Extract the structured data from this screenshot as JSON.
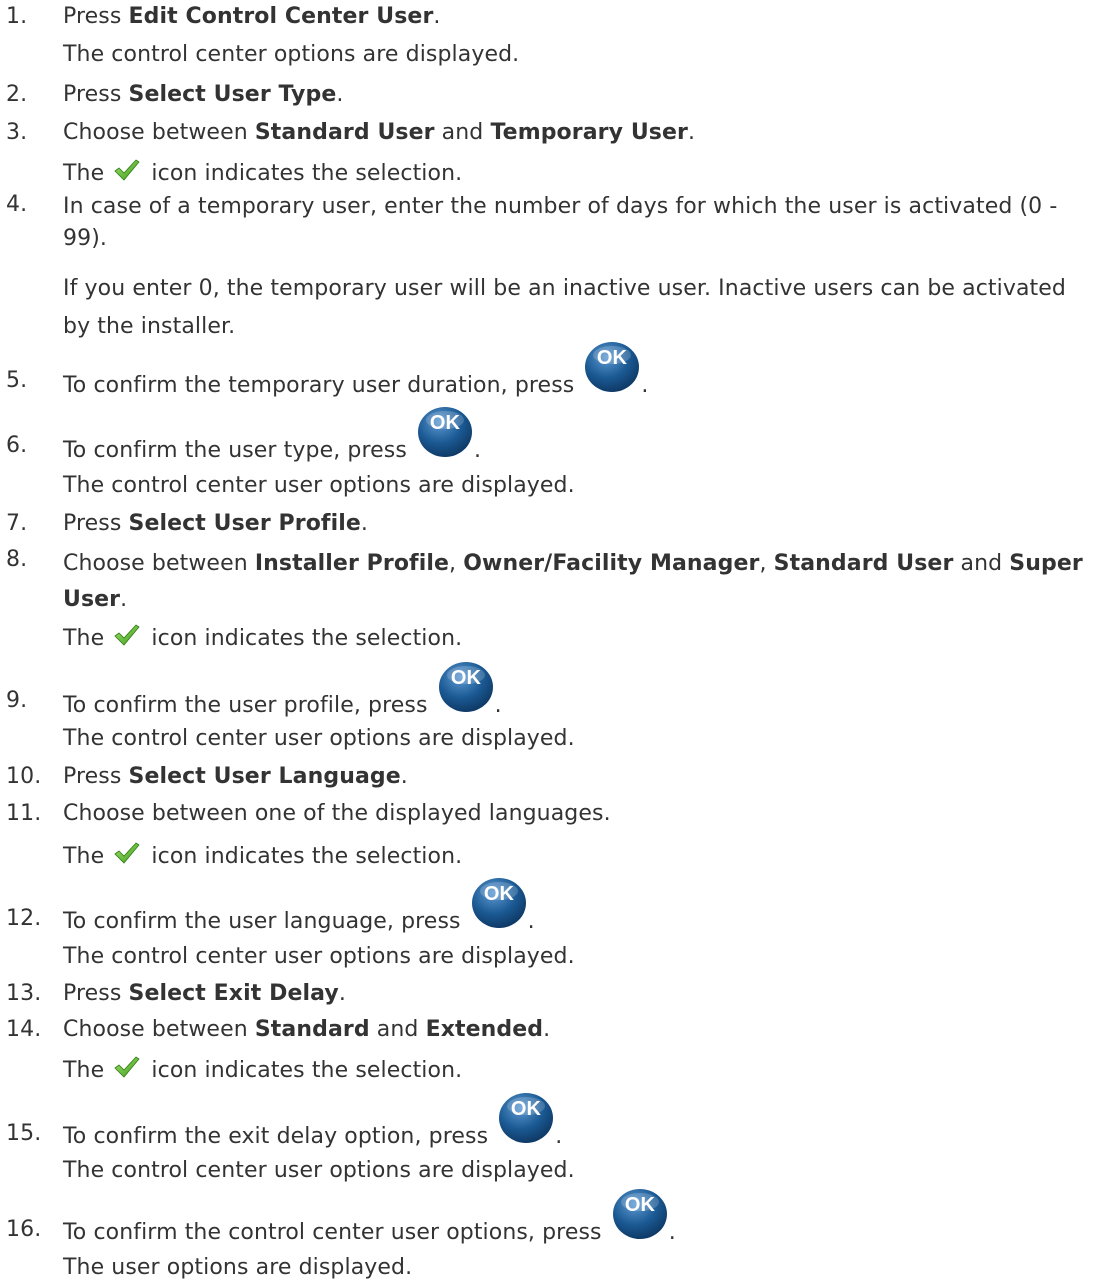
{
  "steps": [
    {
      "num": "1.",
      "pre": "Press ",
      "b1": "Edit Control Center User",
      "post": ".",
      "result": "The control center options are displayed."
    },
    {
      "num": "2.",
      "pre": "Press ",
      "b1": "Select User Type",
      "post": "."
    },
    {
      "num": "3.",
      "pre": "Choose between ",
      "b1": "Standard User",
      "mid": " and ",
      "b2": "Temporary User",
      "post": ".",
      "icon_pre": "The ",
      "icon_post": " icon indicates the selection."
    },
    {
      "num": "4.",
      "text": "In case of a temporary user, enter the number of days for which the user is activated (0 - 99).",
      "result": "If you enter 0, the temporary user will be an inactive user. Inactive users can be activated by the installer."
    },
    {
      "num": "5.",
      "pre": "To confirm the temporary user duration, press ",
      "post": "."
    },
    {
      "num": "6.",
      "pre": "To confirm the user type, press ",
      "post": ".",
      "result": "The control center user options are displayed."
    },
    {
      "num": "7.",
      "pre": "Press ",
      "b1": "Select User Profile",
      "post": "."
    },
    {
      "num": "8.",
      "pre": "Choose between ",
      "b1": "Installer Profile",
      "s1": ", ",
      "b2": "Owner/Facility Manager",
      "s2": ", ",
      "b3": "Standard User",
      "s3": " and ",
      "b4": "Super User",
      "post": ".",
      "icon_pre": "The ",
      "icon_post": " icon indicates the selection."
    },
    {
      "num": "9.",
      "pre": "To confirm the user profile, press ",
      "post": ".",
      "result": "The control center user options are displayed."
    },
    {
      "num": "10.",
      "pre": "Press ",
      "b1": "Select User Language",
      "post": "."
    },
    {
      "num": "11.",
      "text": "Choose between one of the displayed languages.",
      "icon_pre": "The ",
      "icon_post": " icon indicates the selection."
    },
    {
      "num": "12.",
      "pre": "To confirm the user language, press ",
      "post": ".",
      "result": "The control center user options are displayed."
    },
    {
      "num": "13.",
      "pre": "Press ",
      "b1": "Select Exit Delay",
      "post": "."
    },
    {
      "num": "14.",
      "pre": "Choose between ",
      "b1": "Standard",
      "mid": " and ",
      "b2": "Extended",
      "post": ".",
      "icon_pre": "The ",
      "icon_post": " icon indicates the selection."
    },
    {
      "num": "15.",
      "pre": "To confirm the exit delay option, press ",
      "post": ".",
      "result": "The control center user options are displayed."
    },
    {
      "num": "16.",
      "pre": "To confirm the control center user options, press ",
      "post": ".",
      "result": "The user options are displayed."
    }
  ],
  "icons": {
    "check": "checkmark-icon",
    "ok": "ok-button-icon",
    "ok_label": "OK",
    "ok_color": "#1b5a94",
    "check_color": "#5cb82a"
  }
}
